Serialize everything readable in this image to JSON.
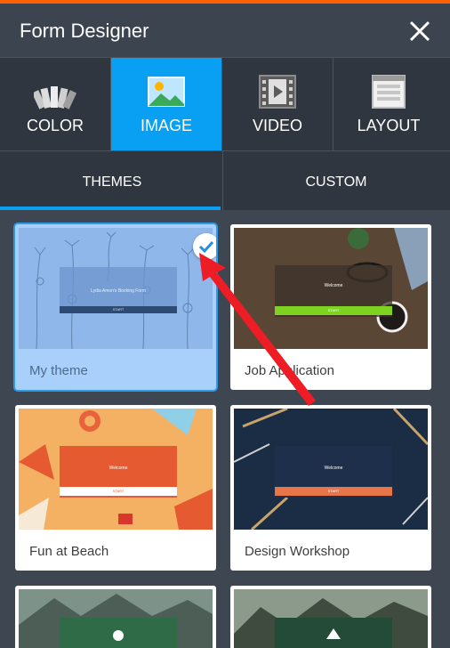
{
  "header": {
    "title": "Form Designer"
  },
  "modes": [
    {
      "label": "COLOR",
      "icon": "color-swatches-icon",
      "active": false
    },
    {
      "label": "IMAGE",
      "icon": "image-icon",
      "active": true
    },
    {
      "label": "VIDEO",
      "icon": "video-film-icon",
      "active": false
    },
    {
      "label": "LAYOUT",
      "icon": "layout-icon",
      "active": false
    }
  ],
  "subtabs": [
    {
      "label": "THEMES",
      "active": true
    },
    {
      "label": "CUSTOM",
      "active": false
    }
  ],
  "themes": [
    {
      "label": "My theme",
      "selected": true,
      "form_title": "Lydia Amon's Booking Form",
      "button": "START"
    },
    {
      "label": "Job Application",
      "selected": false,
      "form_title": "Welcome",
      "button": "START"
    },
    {
      "label": "Fun at Beach",
      "selected": false,
      "form_title": "Welcome",
      "button": "START"
    },
    {
      "label": "Design Workshop",
      "selected": false,
      "form_title": "Welcome",
      "button": "START"
    }
  ],
  "colors": {
    "accent": "#09a0f3",
    "topbar": "#ff6100",
    "panel": "#2f3640",
    "background": "#3e4652",
    "arrow": "#ee1c25"
  }
}
